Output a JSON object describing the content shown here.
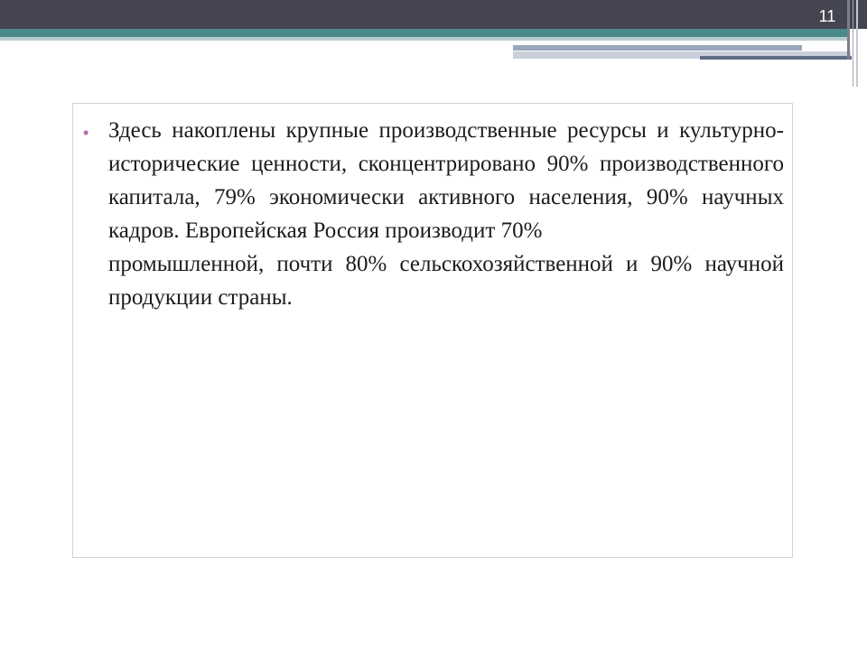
{
  "slide": {
    "number": "11",
    "bullet_glyph": "•",
    "bullet_color": "#b06aa6",
    "accent_bar_color": "#454552",
    "teal_strip_color": "#4a8a8a",
    "text": "Здесь накоплены крупные производственные ресурсы и культурно-исторические ценности, сконцентрировано 90%  производственного капитала, 79%  экономически активного населения, 90%  научных кадров. Европейская Россия производит 70%\n промышленной, почти 80%  сельскохозяйственной и 90%  научной продукции страны."
  }
}
